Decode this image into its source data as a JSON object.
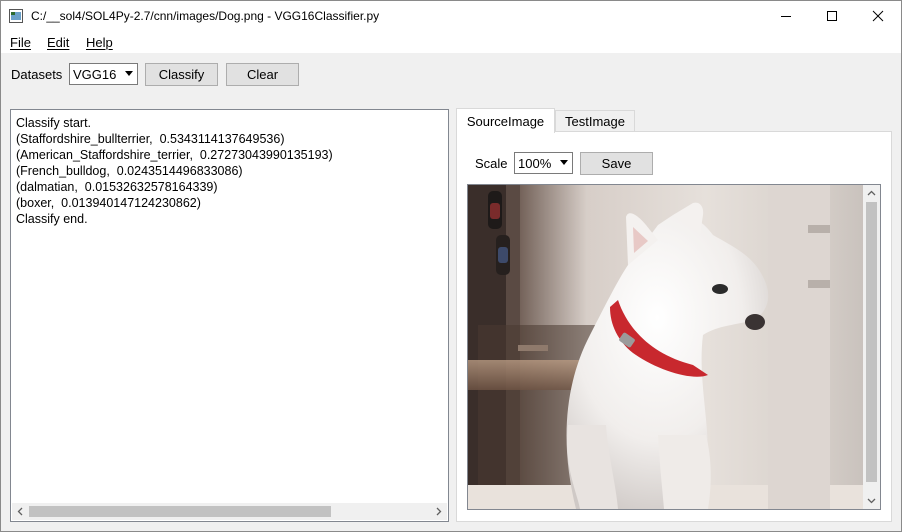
{
  "window": {
    "title": "C:/__sol4/SOL4Py-2.7/cnn/images/Dog.png - VGG16Classifier.py"
  },
  "menu": [
    {
      "label": "File"
    },
    {
      "label": "Edit"
    },
    {
      "label": "Help"
    }
  ],
  "toolbar": {
    "datasets_label": "Datasets",
    "dataset_value": "VGG16",
    "classify_label": "Classify",
    "clear_label": "Clear"
  },
  "output": {
    "lines": [
      "Classify start.",
      "(Staffordshire_bullterrier,  0.5343114137649536)",
      "(American_Staffordshire_terrier,  0.27273043990135193)",
      "(French_bulldog,  0.0243514496833086)",
      "(dalmatian,  0.01532632578164339)",
      "(boxer,  0.013940147124230862)",
      "Classify end."
    ]
  },
  "tabs": [
    {
      "label": "SourceImage",
      "active": true
    },
    {
      "label": "TestImage",
      "active": false
    }
  ],
  "image_panel": {
    "scale_label": "Scale",
    "scale_value": "100%",
    "save_label": "Save"
  },
  "icons": {
    "app": "application-icon",
    "minimize": "minimize-icon",
    "maximize": "maximize-icon",
    "close": "close-icon",
    "dropdown": "chevron-down-icon",
    "scroll_left": "arrow-left-icon",
    "scroll_right": "arrow-right-icon",
    "scroll_up": "arrow-up-icon",
    "scroll_down": "arrow-down-icon"
  }
}
